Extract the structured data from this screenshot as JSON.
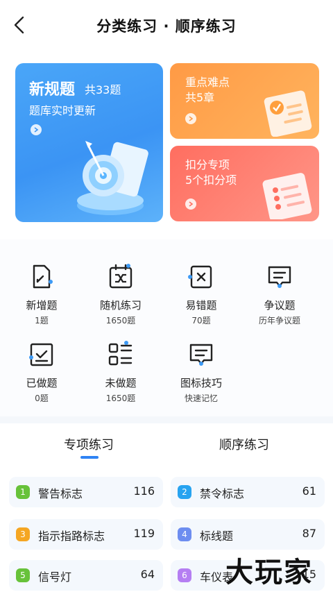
{
  "header": {
    "title": "分类练习 · 顺序练习"
  },
  "banners": {
    "new_rules": {
      "title": "新规题",
      "count": "共33题",
      "subtitle": "题库实时更新"
    },
    "key_points": {
      "line1": "重点难点",
      "line2": "共5章"
    },
    "deduct": {
      "line1": "扣分专项",
      "line2": "5个扣分项"
    }
  },
  "features": [
    {
      "label": "新增题",
      "count": "1题",
      "icon": "new-question-icon"
    },
    {
      "label": "随机练习",
      "count": "1650题",
      "icon": "shuffle-icon"
    },
    {
      "label": "易错题",
      "count": "70题",
      "icon": "wrong-question-icon"
    },
    {
      "label": "争议题",
      "count": "历年争议题",
      "icon": "dispute-icon"
    },
    {
      "label": "已做题",
      "count": "0题",
      "icon": "done-icon"
    },
    {
      "label": "未做题",
      "count": "1650题",
      "icon": "todo-list-icon"
    },
    {
      "label": "图标技巧",
      "count": "快速记忆",
      "icon": "sign-tips-icon"
    }
  ],
  "tabs": [
    {
      "label": "专项练习",
      "active": true
    },
    {
      "label": "顺序练习",
      "active": false
    }
  ],
  "categories": [
    {
      "num": "1",
      "label": "警告标志",
      "count": "116",
      "color": "#67c23a"
    },
    {
      "num": "2",
      "label": "禁令标志",
      "count": "61",
      "color": "#27a3f0"
    },
    {
      "num": "3",
      "label": "指示指路标志",
      "count": "119",
      "color": "#f5a623"
    },
    {
      "num": "4",
      "label": "标线题",
      "count": "87",
      "color": "#6d8df0"
    },
    {
      "num": "5",
      "label": "信号灯",
      "count": "64",
      "color": "#67c23a"
    },
    {
      "num": "6",
      "label": "车仪表",
      "count": "15",
      "color": "#b57ef2"
    }
  ],
  "watermark": "大玩家"
}
